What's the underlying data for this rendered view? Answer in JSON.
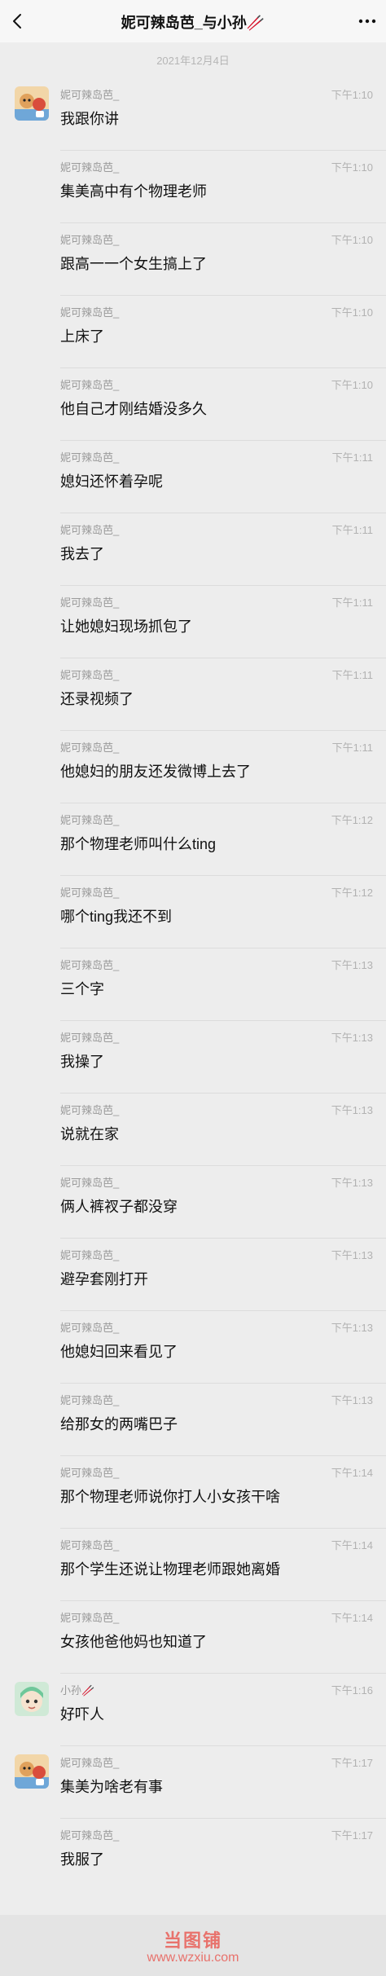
{
  "header": {
    "title": "妮可辣岛芭_与小孙🥢",
    "back_icon": "chevron-left-icon",
    "more_icon": "more-horizontal-icon"
  },
  "date": "2021年12月4日",
  "messages": [
    {
      "sender": "妮可辣岛芭_",
      "time": "下午1:10",
      "text": "我跟你讲",
      "avatar": "nike"
    },
    {
      "sender": "妮可辣岛芭_",
      "time": "下午1:10",
      "text": "集美高中有个物理老师",
      "avatar": ""
    },
    {
      "sender": "妮可辣岛芭_",
      "time": "下午1:10",
      "text": "跟高一一个女生搞上了",
      "avatar": ""
    },
    {
      "sender": "妮可辣岛芭_",
      "time": "下午1:10",
      "text": "上床了",
      "avatar": ""
    },
    {
      "sender": "妮可辣岛芭_",
      "time": "下午1:10",
      "text": "他自己才刚结婚没多久",
      "avatar": ""
    },
    {
      "sender": "妮可辣岛芭_",
      "time": "下午1:11",
      "text": "媳妇还怀着孕呢",
      "avatar": ""
    },
    {
      "sender": "妮可辣岛芭_",
      "time": "下午1:11",
      "text": "我去了",
      "avatar": ""
    },
    {
      "sender": "妮可辣岛芭_",
      "time": "下午1:11",
      "text": "让她媳妇现场抓包了",
      "avatar": ""
    },
    {
      "sender": "妮可辣岛芭_",
      "time": "下午1:11",
      "text": "还录视频了",
      "avatar": ""
    },
    {
      "sender": "妮可辣岛芭_",
      "time": "下午1:11",
      "text": "他媳妇的朋友还发微博上去了",
      "avatar": ""
    },
    {
      "sender": "妮可辣岛芭_",
      "time": "下午1:12",
      "text": "那个物理老师叫什么ting",
      "avatar": ""
    },
    {
      "sender": "妮可辣岛芭_",
      "time": "下午1:12",
      "text": "哪个ting我还不到",
      "avatar": ""
    },
    {
      "sender": "妮可辣岛芭_",
      "time": "下午1:13",
      "text": "三个字",
      "avatar": ""
    },
    {
      "sender": "妮可辣岛芭_",
      "time": "下午1:13",
      "text": "我操了",
      "avatar": ""
    },
    {
      "sender": "妮可辣岛芭_",
      "time": "下午1:13",
      "text": "说就在家",
      "avatar": ""
    },
    {
      "sender": "妮可辣岛芭_",
      "time": "下午1:13",
      "text": "俩人裤衩子都没穿",
      "avatar": ""
    },
    {
      "sender": "妮可辣岛芭_",
      "time": "下午1:13",
      "text": "避孕套刚打开",
      "avatar": ""
    },
    {
      "sender": "妮可辣岛芭_",
      "time": "下午1:13",
      "text": "他媳妇回来看见了",
      "avatar": ""
    },
    {
      "sender": "妮可辣岛芭_",
      "time": "下午1:13",
      "text": "给那女的两嘴巴子",
      "avatar": ""
    },
    {
      "sender": "妮可辣岛芭_",
      "time": "下午1:14",
      "text": "那个物理老师说你打人小女孩干啥",
      "avatar": ""
    },
    {
      "sender": "妮可辣岛芭_",
      "time": "下午1:14",
      "text": "那个学生还说让物理老师跟她离婚",
      "avatar": ""
    },
    {
      "sender": "妮可辣岛芭_",
      "time": "下午1:14",
      "text": "女孩他爸他妈也知道了",
      "avatar": ""
    },
    {
      "sender": "小孙🥢",
      "time": "下午1:16",
      "text": "好吓人",
      "avatar": "xiaosun"
    },
    {
      "sender": "妮可辣岛芭_",
      "time": "下午1:17",
      "text": "集美为啥老有事",
      "avatar": "nike"
    },
    {
      "sender": "妮可辣岛芭_",
      "time": "下午1:17",
      "text": "我服了",
      "avatar": ""
    }
  ],
  "watermark": {
    "logo": "当图铺",
    "url": "www.wzxiu.com"
  },
  "colors": {
    "background": "#ededed",
    "header_bg": "#f7f7f7",
    "watermark": "#e8726c"
  }
}
